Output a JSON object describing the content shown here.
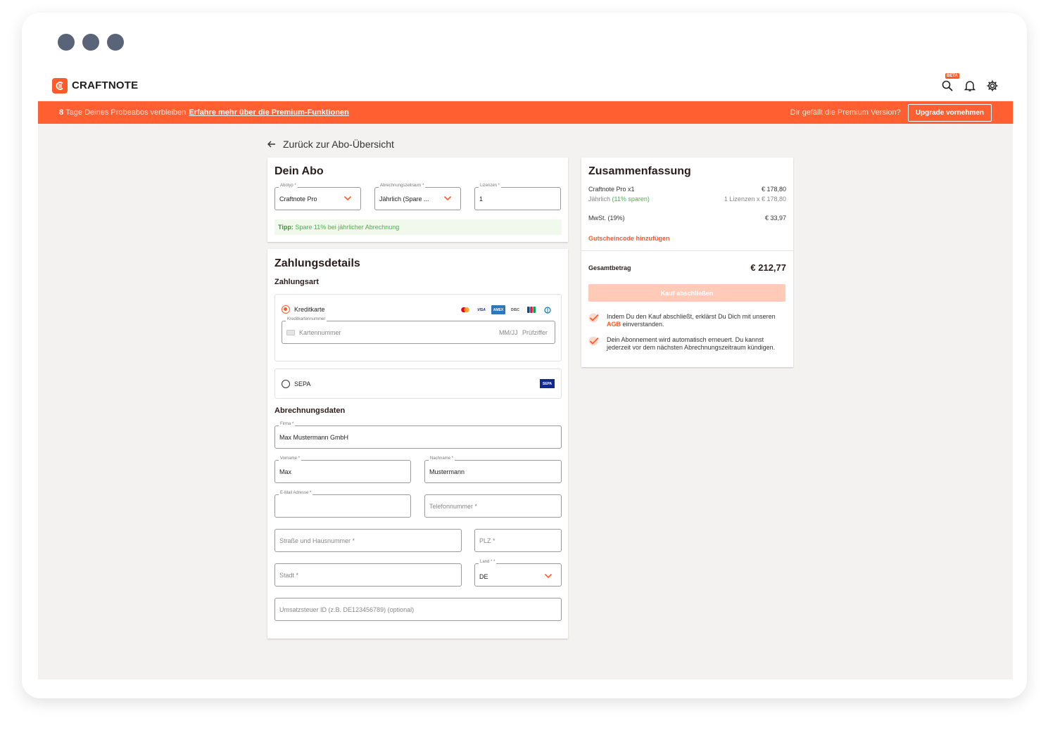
{
  "brand": {
    "name": "CRAFTNOTE",
    "accent": "#ff5a2c"
  },
  "topbar": {
    "beta_badge": "BETA",
    "icons": [
      "search-icon",
      "bell-icon",
      "gear-icon"
    ]
  },
  "banner": {
    "days": "8",
    "text": "Tage Deines Probeabos verbleiben",
    "link": "Erfahre mehr über die Premium-Funktionen",
    "question": "Dir gefällt die Premium Version?",
    "upgrade_label": "Upgrade vornehmen"
  },
  "back_link": "Zurück zur Abo-Übersicht",
  "abo": {
    "title": "Dein Abo",
    "abotyp_label": "Abotyp *",
    "abotyp_value": "Craftnote Pro",
    "zeitraum_label": "Abrechnungszeitraum *",
    "zeitraum_value": "Jährlich (Spare ...",
    "lizenzen_label": "Lizenzen *",
    "lizenzen_value": "1",
    "tip_bold": "Tipp:",
    "tip_text": "Spare 11% bei jährlicher Abrechnung"
  },
  "payment": {
    "title": "Zahlungsdetails",
    "subtitle": "Zahlungsart",
    "credit_label": "Kreditkarte",
    "cc_field_label": "Kreditkartennummer",
    "cc_placeholder": "Kartennummer",
    "cc_expiry": "MM/JJ",
    "cc_cvc": "Prüfziffer",
    "sepa_label": "SEPA",
    "card_logos": [
      "mastercard",
      "visa",
      "amex",
      "discover",
      "jcb",
      "diners"
    ],
    "sepa_logo": "SEPA"
  },
  "billing": {
    "title": "Abrechnungsdaten",
    "firma_label": "Firma *",
    "firma_value": "Max Mustermann GmbH",
    "vorname_label": "Vorname *",
    "vorname_value": "Max",
    "nachname_label": "Nachname *",
    "nachname_value": "Mustermann",
    "email_label": "E-Mail Adresse *",
    "telefon_placeholder": "Telefonnummer *",
    "strasse_placeholder": "Straße und Hausnummer *",
    "plz_placeholder": "PLZ *",
    "stadt_placeholder": "Stadt *",
    "land_label": "Land * *",
    "land_value": "DE",
    "ust_placeholder": "Umsatzsteuer ID (z.B. DE123456789) (optional)"
  },
  "summary": {
    "title": "Zusammenfassung",
    "product": "Craftnote Pro x1",
    "product_price": "€ 178,80",
    "billing_cycle": "Jährlich",
    "savings": "(11% sparen)",
    "licenses_detail": "1 Lizenzen x € 178,80",
    "tax_label": "MwSt. (19%)",
    "tax_value": "€ 33,97",
    "voucher_link": "Gutscheincode hinzufügen",
    "total_label": "Gesamtbetrag",
    "total_value": "€ 212,77",
    "buy_label": "Kauf abschließen",
    "check1_a": "Indem Du den Kauf abschließt, erklärst Du Dich mit unseren",
    "check1_agb": "AGB",
    "check1_b": "einverstanden.",
    "check2": "Dein Abonnement wird automatisch erneuert. Du kannst jederzeit vor dem nächsten Abrechnungszeitraum kündigen."
  }
}
